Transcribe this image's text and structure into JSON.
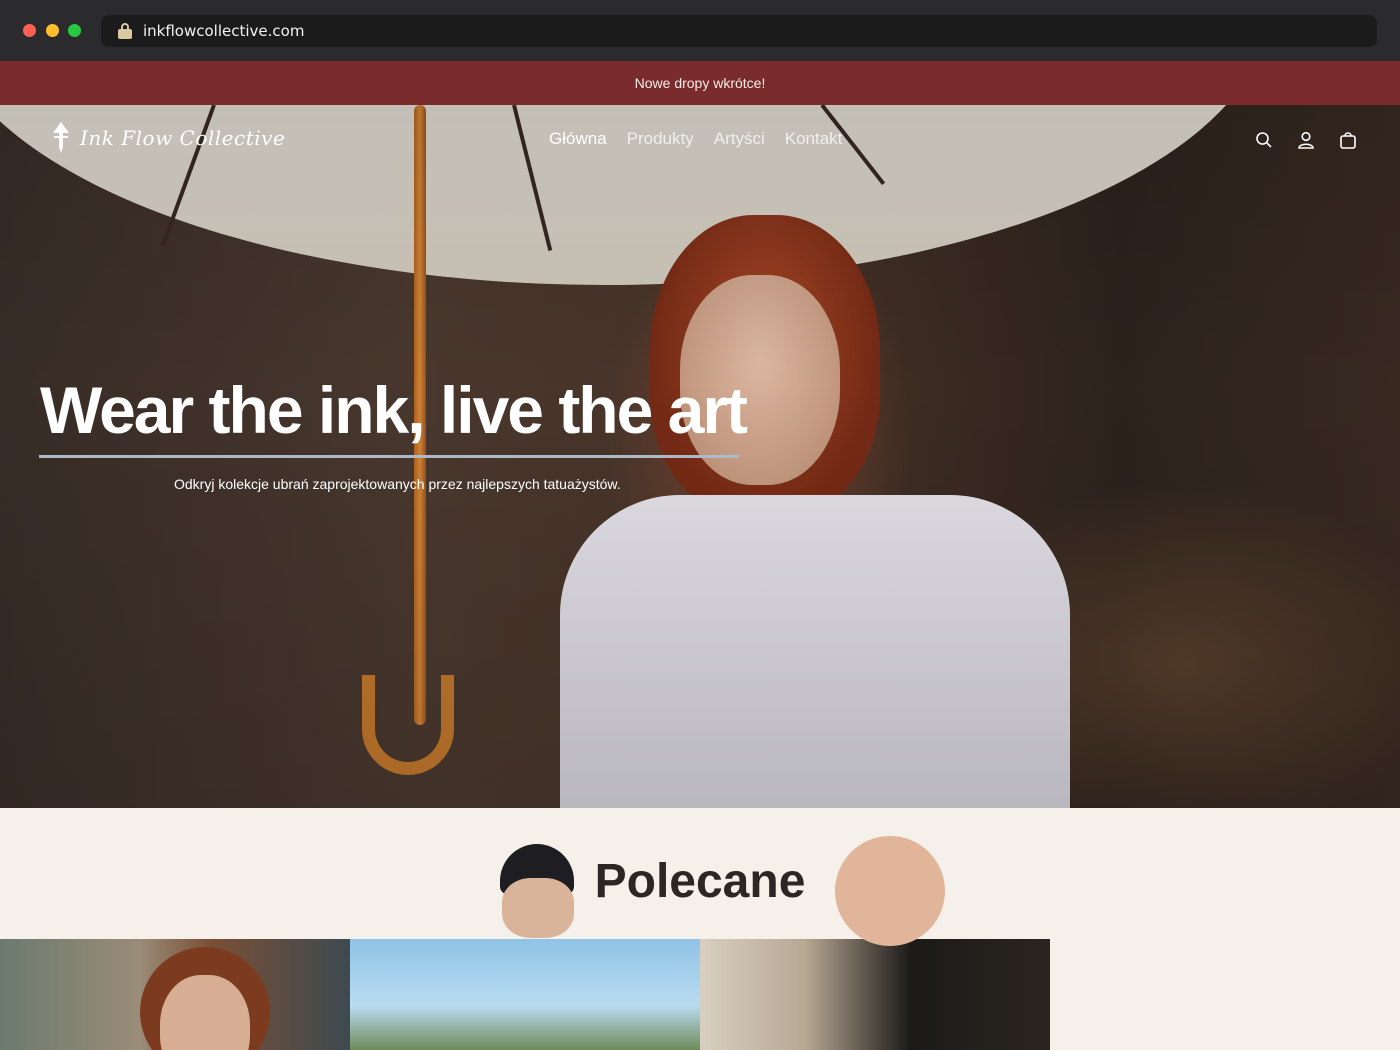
{
  "browser": {
    "url": "inkflowcollective.com"
  },
  "announcement": {
    "text": "Nowe dropy wkrótce!",
    "background": "#7a2b2b"
  },
  "header": {
    "logo_text": "Ink Flow Collective",
    "nav": [
      {
        "label": "Główna",
        "active": true
      },
      {
        "label": "Produkty",
        "active": false
      },
      {
        "label": "Artyści",
        "active": false
      },
      {
        "label": "Kontakt",
        "active": false
      }
    ],
    "icons": [
      "search-icon",
      "account-icon",
      "cart-icon"
    ]
  },
  "hero": {
    "headline": "Wear the ink, live the art",
    "subheadline": "Odkryj kolekcje ubrań zaprojektowanych przez najlepszych tatuażystów.",
    "underline_color": "#aeb9c7"
  },
  "featured": {
    "title": "Polecane"
  }
}
